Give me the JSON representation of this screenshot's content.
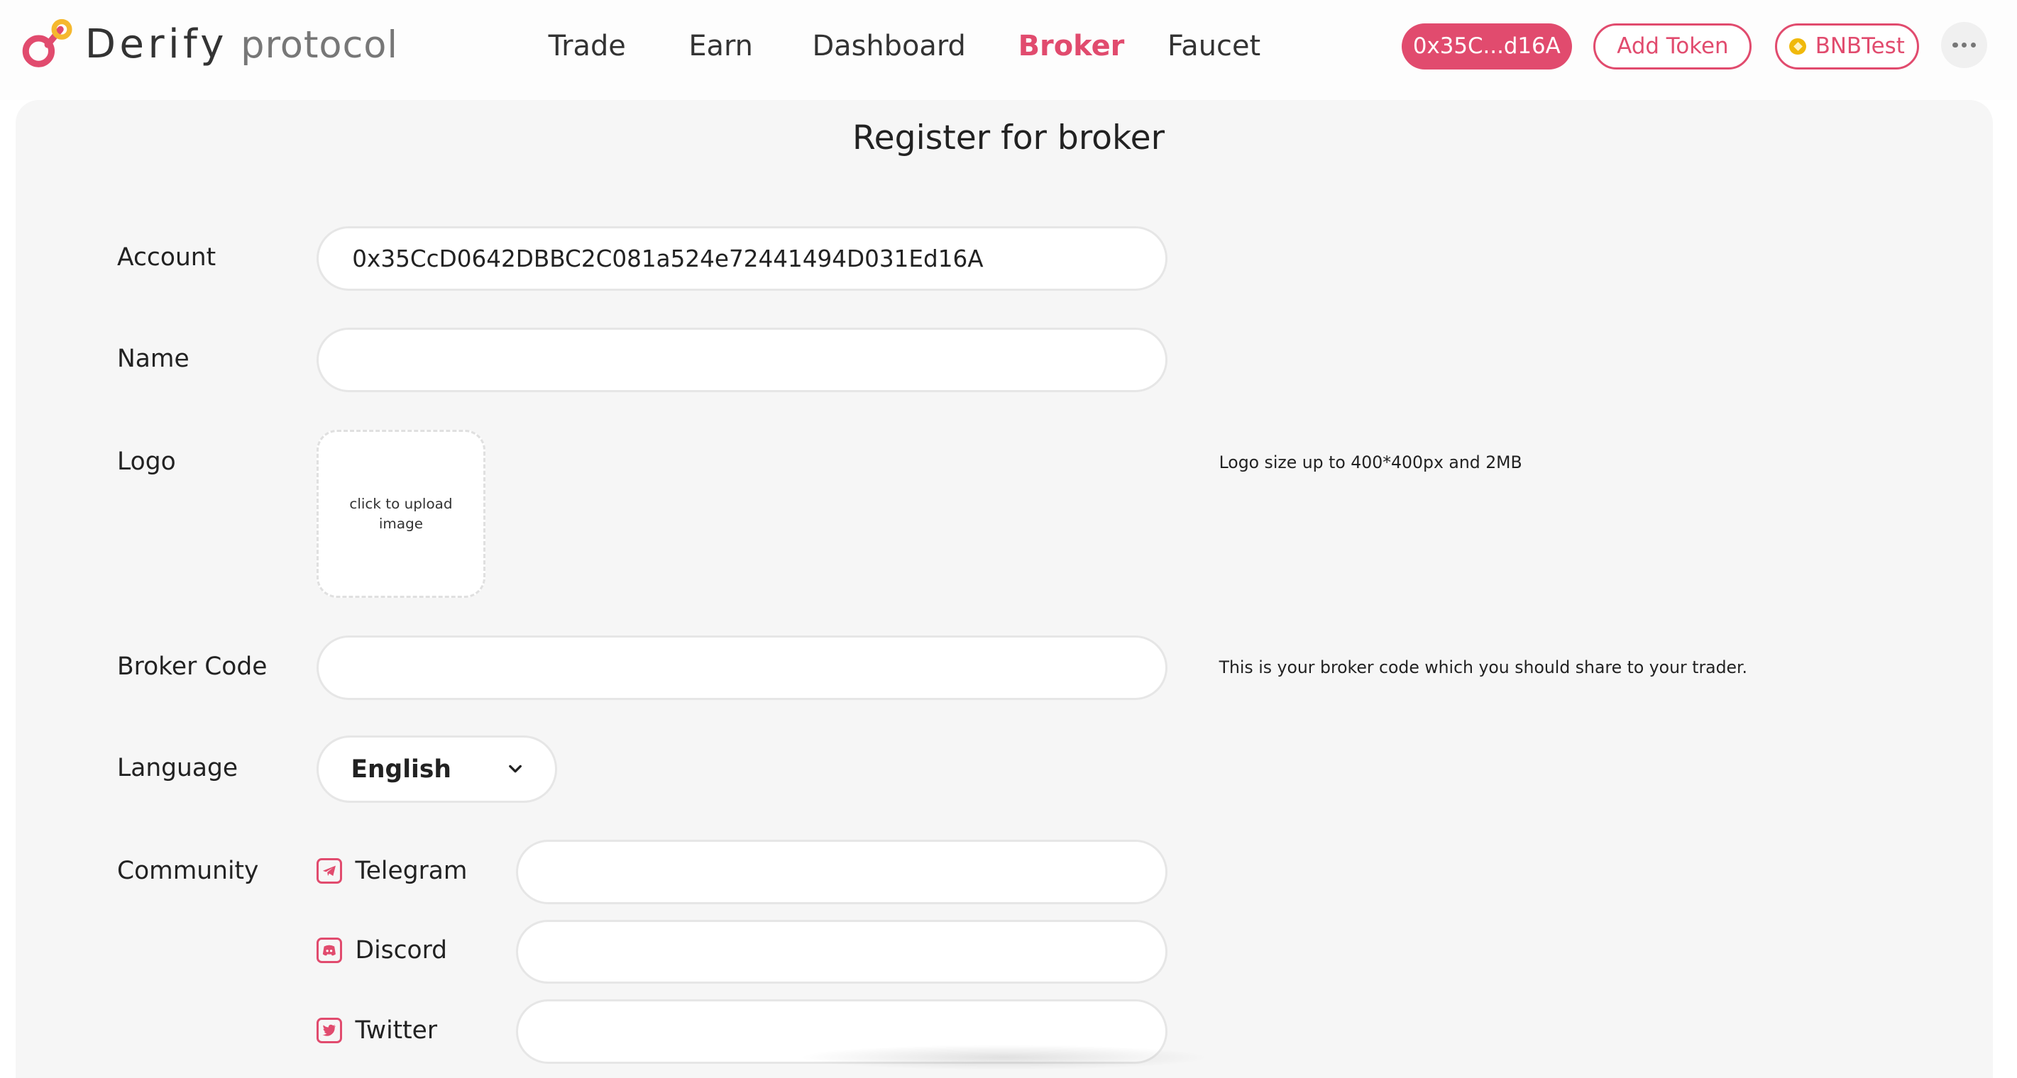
{
  "header": {
    "brand": "Derify",
    "brand_sub": "protocol",
    "nav": [
      {
        "label": "Trade",
        "active": false
      },
      {
        "label": "Earn",
        "active": false
      },
      {
        "label": "Dashboard",
        "active": false
      },
      {
        "label": "Broker",
        "active": true
      },
      {
        "label": "Faucet",
        "active": false
      }
    ],
    "wallet_address": "0x35C...d16A",
    "add_token_label": "Add Token",
    "network_label": "BNBTest",
    "more_icon": "ellipsis-icon"
  },
  "form": {
    "title": "Register for broker",
    "account_label": "Account",
    "account_value": "0x35CcD0642DBBC2C081a524e72441494D031Ed16A",
    "name_label": "Name",
    "name_value": "",
    "logo_label": "Logo",
    "logo_upload_text": "click to upload image",
    "logo_hint": "Logo size up to 400*400px and 2MB",
    "broker_code_label": "Broker Code",
    "broker_code_value": "",
    "broker_code_hint": "This is your broker code which you should share to your trader.",
    "language_label": "Language",
    "language_value": "English",
    "community_label": "Community",
    "community": [
      {
        "label": "Telegram",
        "icon": "telegram-icon",
        "value": ""
      },
      {
        "label": "Discord",
        "icon": "discord-icon",
        "value": ""
      },
      {
        "label": "Twitter",
        "icon": "twitter-icon",
        "value": ""
      }
    ]
  },
  "colors": {
    "accent": "#e14b6e",
    "logo_yellow": "#f5b82e",
    "card_bg": "#f6f6f6"
  }
}
